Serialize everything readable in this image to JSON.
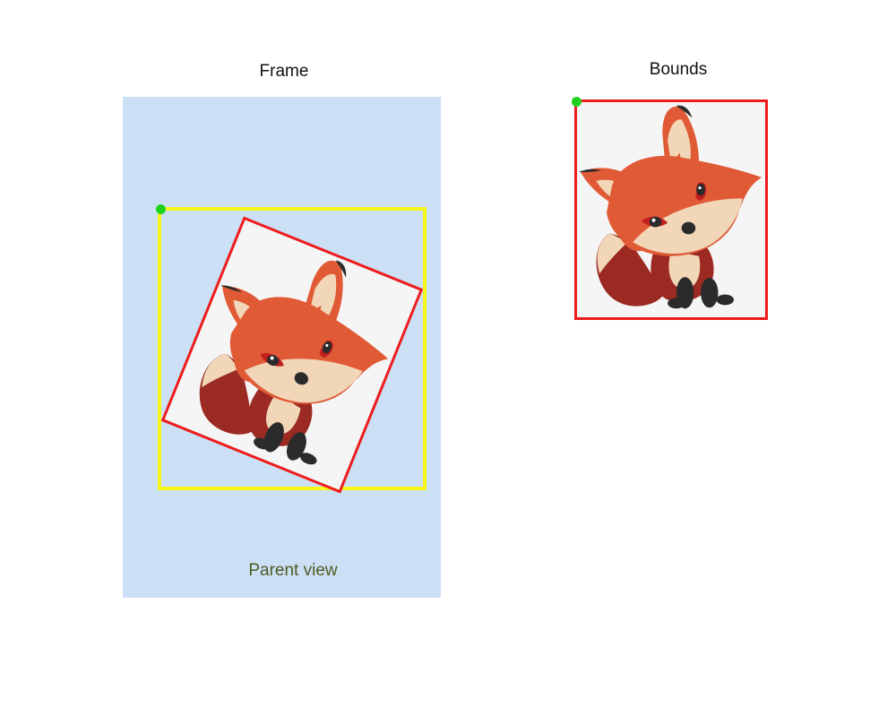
{
  "titles": {
    "frame": "Frame",
    "bounds": "Bounds"
  },
  "parent_view": {
    "label": "Parent view"
  },
  "colors": {
    "parent_fill": "#cce0f5",
    "frame_outline": "#f7f71a",
    "view_outline": "#ee1c1c",
    "origin_dot": "#1fd11f",
    "image_background": "#f5f5f5",
    "fox_orange": "#e05a35",
    "fox_cream": "#f1d6b8",
    "fox_dark_red": "#9b2a22",
    "fox_black": "#2b2b2b"
  },
  "image": {
    "subject": "fox-illustration",
    "rotation_degrees": 22
  }
}
